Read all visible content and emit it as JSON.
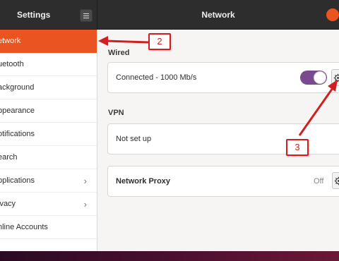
{
  "window": {
    "app_title": "Settings",
    "page_title": "Network"
  },
  "sidebar": {
    "items": [
      {
        "label": "etwork",
        "active": true
      },
      {
        "label": "uetooth"
      },
      {
        "label": "ackground"
      },
      {
        "label": "ppearance"
      },
      {
        "label": "otifications"
      },
      {
        "label": "earch"
      },
      {
        "label": "pplications",
        "has_submenu": true
      },
      {
        "label": "ivacy",
        "has_submenu": true
      },
      {
        "label": "nline Accounts"
      }
    ],
    "chevron": "›"
  },
  "wired": {
    "title": "Wired",
    "status": "Connected - 1000 Mb/s",
    "enabled": true
  },
  "vpn": {
    "title": "VPN",
    "status": "Not set up"
  },
  "proxy": {
    "label": "Network Proxy",
    "state": "Off"
  },
  "annotations": {
    "callout_2": "2",
    "callout_3": "3",
    "color": "#d11f1f"
  },
  "icons": {
    "menu": "hamburger-icon",
    "settings": "gear-icon",
    "close": "close-icon"
  },
  "colors": {
    "accent": "#e95420",
    "toggle_on": "#7a4a8f",
    "titlebar": "#2d2d2d"
  }
}
